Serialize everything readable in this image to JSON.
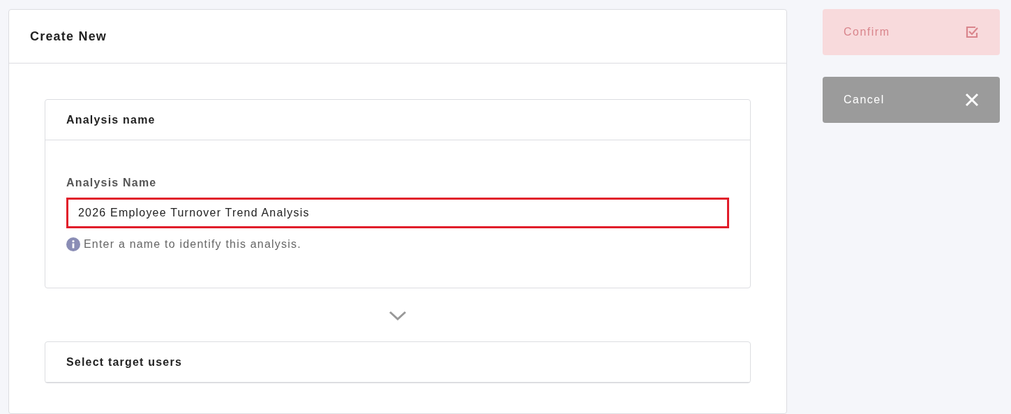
{
  "panel": {
    "title": "Create New"
  },
  "sections": [
    {
      "title": "Analysis name",
      "field": {
        "label": "Analysis Name",
        "value": "2026 Employee Turnover Trend Analysis",
        "highlighted": true,
        "hint": "Enter a name to identify this analysis."
      }
    },
    {
      "title": "Select target users"
    }
  ],
  "actions": [
    {
      "kind": "confirm",
      "label": "Confirm",
      "disabled": true
    },
    {
      "kind": "cancel",
      "label": "Cancel",
      "disabled": false
    }
  ]
}
